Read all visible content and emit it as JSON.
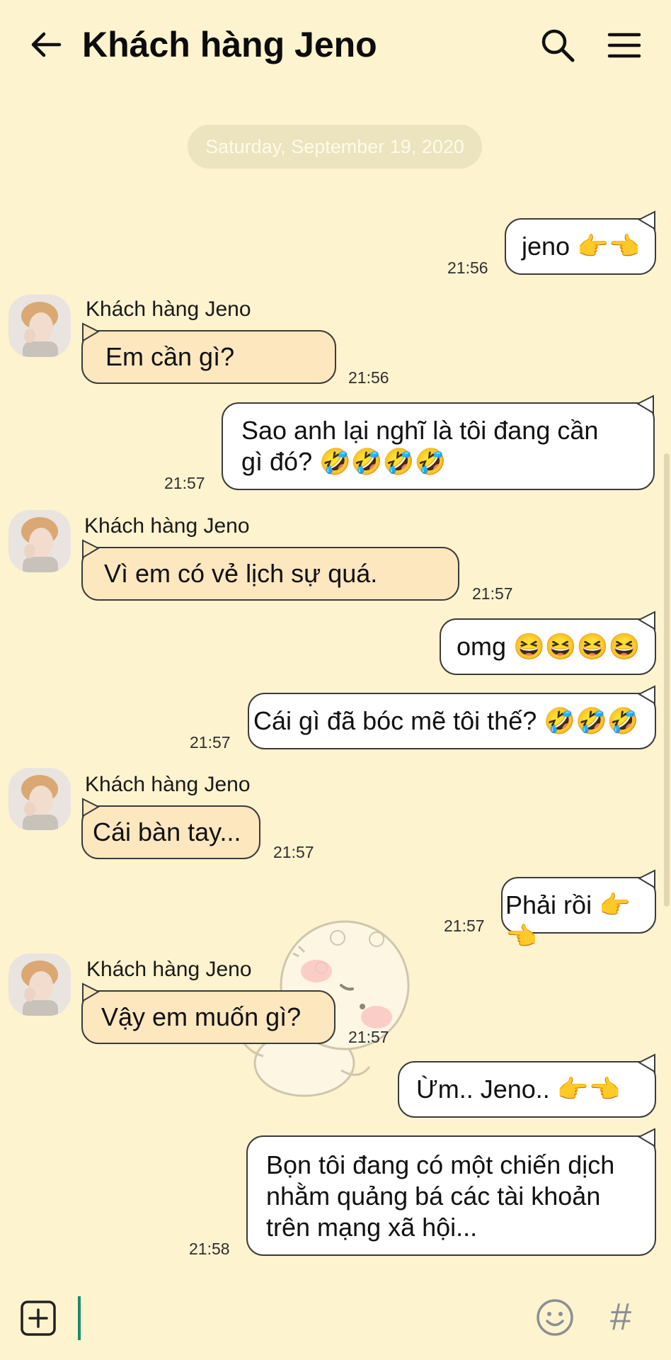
{
  "header": {
    "title": "Khách hàng Jeno",
    "back_icon": "arrow-left-icon",
    "search_icon": "search-icon",
    "menu_icon": "hamburger-menu-icon"
  },
  "date_separator": "Saturday, September 19, 2020",
  "contact_name": "Khách hàng Jeno",
  "messages": [
    {
      "dir": "out",
      "text": "jeno 👉👈",
      "time": "21:56"
    },
    {
      "dir": "in",
      "text": "Em cần gì?",
      "time": "21:56"
    },
    {
      "dir": "out",
      "line1": "Sao anh lại nghĩ là tôi đang cần",
      "line2": "gì đó? 🤣🤣🤣🤣",
      "time": "21:57"
    },
    {
      "dir": "in",
      "text": "Vì em có vẻ lịch sự quá.",
      "time": "21:57"
    },
    {
      "dir": "out",
      "text": "omg 😆😆😆😆"
    },
    {
      "dir": "out",
      "text": "Cái gì đã bóc mẽ tôi thế? 🤣🤣🤣",
      "time": "21:57"
    },
    {
      "dir": "in",
      "text": "Cái bàn tay...",
      "time": "21:57"
    },
    {
      "dir": "out",
      "text": "Phải rồi 👉👈",
      "time": "21:57"
    },
    {
      "dir": "in",
      "text": "Vậy em muốn gì?",
      "time": "21:57"
    },
    {
      "dir": "out",
      "text": "Ừm.. Jeno.. 👉👈"
    },
    {
      "dir": "out",
      "line1": "Bọn tôi đang có một chiến dịch",
      "line2": "nhằm quảng bá các tài khoản",
      "line3": "trên mạng xã hội...",
      "time": "21:58"
    }
  ],
  "input_bar": {
    "plus_icon": "add-square-icon",
    "emoji_icon": "smiley-icon",
    "hash_label": "#"
  },
  "colors": {
    "background": "#fdf3cf",
    "incoming_bubble": "#fde7bf",
    "outgoing_bubble": "#ffffff",
    "date_pill": "#ece3bf",
    "cursor": "#1e8a6a"
  }
}
